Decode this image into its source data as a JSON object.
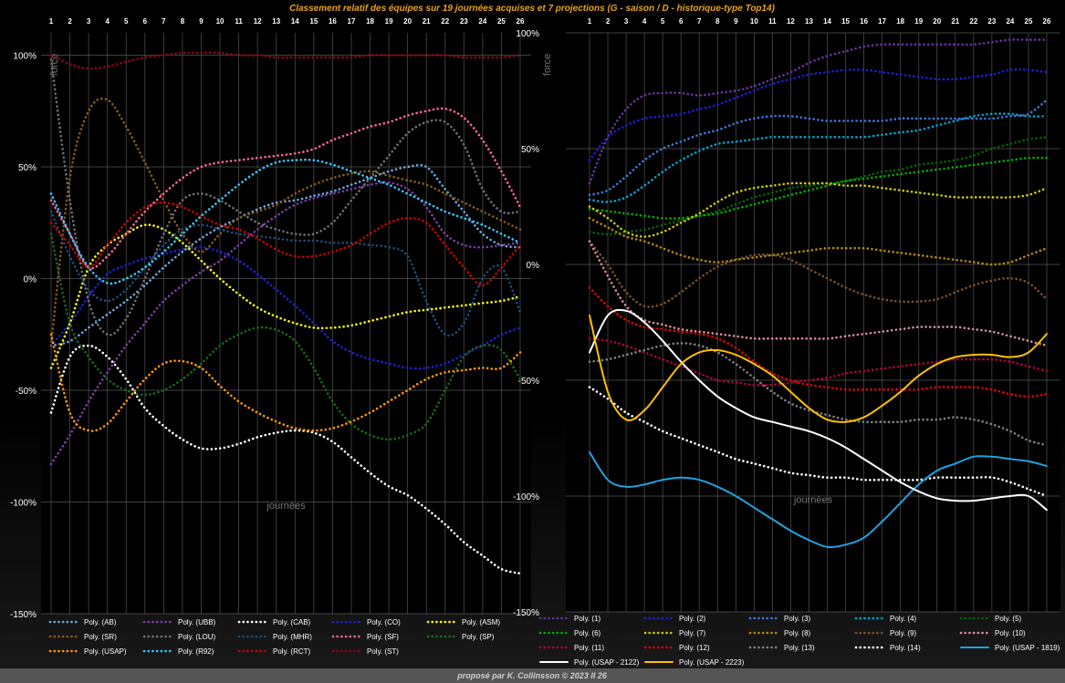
{
  "title": "Classement relatif des équipes sur 19 journées acquises et 7 projections  (G - saison   /   D - historique-type Top14)",
  "footer": "proposé par K. Collinsson  ©  2023 II 26",
  "colors": {
    "background": "#000000",
    "title": "#e8a317",
    "gridline": "#555555"
  },
  "chart_data": [
    {
      "type": "line",
      "panel": "left",
      "x": [
        1,
        2,
        3,
        4,
        5,
        6,
        7,
        8,
        9,
        10,
        11,
        12,
        13,
        14,
        15,
        16,
        17,
        18,
        19,
        20,
        21,
        22,
        23,
        24,
        25,
        26
      ],
      "xlabel": "journées",
      "ylabel": "force",
      "ylim": [
        -150,
        110
      ],
      "yticks": [
        100,
        50,
        0,
        -50,
        -100,
        -150
      ],
      "ytick_labels": [
        "100%",
        "50%",
        "0%",
        "-50%",
        "-100%",
        "-150%"
      ],
      "grid": true,
      "legend_position": "bottom",
      "series": [
        {
          "name": "Poly. (AB)",
          "color": "#6fa8dc",
          "style": "dotted",
          "values": [
            -30,
            -28,
            -22,
            -16,
            -10,
            -3,
            5,
            12,
            18,
            23,
            27,
            31,
            34,
            35,
            37,
            39,
            42,
            45,
            48,
            50,
            50,
            40,
            30,
            20,
            15,
            14
          ]
        },
        {
          "name": "Poly. (UBB)",
          "color": "#7e3fa6",
          "style": "dotted",
          "values": [
            -83,
            -70,
            -55,
            -42,
            -30,
            -20,
            -10,
            -3,
            3,
            8,
            15,
            22,
            28,
            33,
            36,
            38,
            40,
            42,
            43,
            40,
            32,
            20,
            15,
            14,
            15,
            16
          ]
        },
        {
          "name": "Poly. (CAB)",
          "color": "#ffffff",
          "style": "dotted",
          "values": [
            -60,
            -35,
            -30,
            -35,
            -45,
            -58,
            -66,
            -72,
            -76,
            -76,
            -74,
            -71,
            -69,
            -68,
            -69,
            -73,
            -80,
            -87,
            -93,
            -97,
            -103,
            -110,
            -118,
            -124,
            -130,
            -132
          ]
        },
        {
          "name": "Poly. (CO)",
          "color": "#1f1fd6",
          "style": "dotted",
          "values": [
            -30,
            -20,
            -8,
            2,
            6,
            9,
            11,
            13,
            14,
            12,
            8,
            2,
            -5,
            -12,
            -20,
            -28,
            -33,
            -36,
            -38,
            -40,
            -40,
            -38,
            -34,
            -30,
            -25,
            -22
          ]
        },
        {
          "name": "Poly. (ASM)",
          "color": "#ffff00",
          "style": "dotted",
          "values": [
            -40,
            -20,
            5,
            15,
            20,
            24,
            22,
            16,
            8,
            0,
            -7,
            -13,
            -17,
            -20,
            -22,
            -22,
            -21,
            -19,
            -17,
            -15,
            -14,
            -13,
            -12,
            -11,
            -10,
            -8
          ]
        },
        {
          "name": "Poly. (SR)",
          "color": "#8b5a1a",
          "style": "dotted",
          "values": [
            -30,
            45,
            75,
            80,
            68,
            52,
            35,
            20,
            12,
            20,
            27,
            30,
            33,
            38,
            42,
            45,
            47,
            48,
            46,
            44,
            42,
            38,
            34,
            30,
            26,
            22
          ]
        },
        {
          "name": "Poly. (LOU)",
          "color": "#707070",
          "style": "dotted",
          "values": [
            98,
            35,
            -10,
            -25,
            -18,
            0,
            20,
            35,
            38,
            35,
            30,
            25,
            22,
            20,
            20,
            25,
            35,
            45,
            55,
            65,
            70,
            70,
            60,
            40,
            30,
            30
          ]
        },
        {
          "name": "Poly. (MHR)",
          "color": "#1f4e79",
          "style": "dotted",
          "values": [
            30,
            10,
            -5,
            -10,
            -5,
            5,
            15,
            22,
            24,
            22,
            20,
            19,
            18,
            17,
            17,
            16,
            16,
            15,
            14,
            10,
            -10,
            -25,
            -20,
            0,
            5,
            -15
          ]
        },
        {
          "name": "Poly. (SF)",
          "color": "#ff6699",
          "style": "dotted",
          "values": [
            35,
            20,
            5,
            10,
            20,
            30,
            38,
            45,
            50,
            52,
            53,
            54,
            55,
            56,
            58,
            62,
            65,
            68,
            70,
            73,
            75,
            76,
            72,
            62,
            48,
            32
          ]
        },
        {
          "name": "Poly. (SP)",
          "color": "#1a6b1a",
          "style": "dotted",
          "values": [
            20,
            -20,
            -35,
            -45,
            -50,
            -52,
            -50,
            -45,
            -38,
            -30,
            -25,
            -22,
            -23,
            -28,
            -40,
            -55,
            -65,
            -70,
            -72,
            -70,
            -65,
            -50,
            -35,
            -30,
            -32,
            -45
          ]
        },
        {
          "name": "Poly. (USAP)",
          "color": "#ff9900",
          "style": "dotted",
          "values": [
            -25,
            -60,
            -68,
            -65,
            -55,
            -45,
            -38,
            -37,
            -40,
            -48,
            -55,
            -60,
            -64,
            -67,
            -68,
            -67,
            -64,
            -60,
            -55,
            -50,
            -45,
            -42,
            -41,
            -40,
            -40,
            -33
          ]
        },
        {
          "name": "Poly. (R92)",
          "color": "#33ccff",
          "style": "dotted",
          "values": [
            38,
            20,
            5,
            -2,
            0,
            5,
            12,
            20,
            28,
            35,
            42,
            48,
            52,
            53,
            53,
            51,
            48,
            45,
            42,
            38,
            34,
            30,
            27,
            24,
            20,
            16
          ]
        },
        {
          "name": "Poly. (RCT)",
          "color": "#cc0000",
          "style": "dotted",
          "values": [
            25,
            15,
            5,
            15,
            25,
            32,
            34,
            32,
            28,
            24,
            22,
            18,
            13,
            10,
            10,
            12,
            15,
            20,
            25,
            27,
            25,
            15,
            5,
            -3,
            5,
            15
          ]
        },
        {
          "name": "Poly. (ST)",
          "color": "#99001a",
          "style": "dotted",
          "values": [
            100,
            96,
            94,
            95,
            97,
            99,
            100,
            101,
            101,
            101,
            100,
            100,
            99,
            99,
            99,
            99,
            99,
            100,
            100,
            100,
            100,
            100,
            99,
            99,
            99,
            100
          ]
        }
      ]
    },
    {
      "type": "line",
      "panel": "right",
      "x": [
        1,
        2,
        3,
        4,
        5,
        6,
        7,
        8,
        9,
        10,
        11,
        12,
        13,
        14,
        15,
        16,
        17,
        18,
        19,
        20,
        21,
        22,
        23,
        24,
        25,
        26
      ],
      "xlabel": "journées",
      "ylabel": "force",
      "ylim": [
        -150,
        100
      ],
      "yticks": [
        100,
        50,
        0,
        -50,
        -100,
        -150
      ],
      "ytick_labels": [
        "100%",
        "50%",
        "0%",
        "-50%",
        "-100%",
        "-150%"
      ],
      "grid": true,
      "legend_position": "bottom",
      "series": [
        {
          "name": "Poly. (1)",
          "color": "#6a329f",
          "style": "dotted",
          "values": [
            35,
            55,
            67,
            73,
            74,
            74,
            73,
            74,
            75,
            77,
            80,
            83,
            87,
            90,
            92,
            94,
            95,
            95,
            95,
            95,
            95,
            95,
            96,
            97,
            97,
            97
          ]
        },
        {
          "name": "Poly. (2)",
          "color": "#1f1fd6",
          "style": "dotted",
          "values": [
            45,
            55,
            60,
            63,
            64,
            65,
            67,
            69,
            72,
            75,
            78,
            80,
            82,
            83,
            84,
            84,
            83,
            82,
            81,
            80,
            80,
            81,
            82,
            84,
            84,
            83
          ]
        },
        {
          "name": "Poly. (3)",
          "color": "#3c78d8",
          "style": "dotted",
          "values": [
            30,
            32,
            38,
            45,
            50,
            53,
            56,
            58,
            61,
            63,
            64,
            64,
            63,
            62,
            62,
            62,
            62,
            63,
            63,
            63,
            63,
            63,
            63,
            64,
            65,
            71
          ]
        },
        {
          "name": "Poly. (4)",
          "color": "#00a3cc",
          "style": "dotted",
          "values": [
            28,
            27,
            29,
            34,
            40,
            45,
            49,
            52,
            53,
            54,
            55,
            55,
            55,
            55,
            55,
            55,
            56,
            57,
            58,
            60,
            62,
            64,
            65,
            65,
            64,
            64
          ]
        },
        {
          "name": "Poly. (5)",
          "color": "#006400",
          "style": "dotted",
          "values": [
            14,
            13,
            14,
            15,
            17,
            19,
            21,
            23,
            26,
            29,
            31,
            33,
            34,
            35,
            36,
            38,
            40,
            41,
            43,
            44,
            45,
            47,
            50,
            52,
            54,
            55
          ]
        },
        {
          "name": "Poly. (6)",
          "color": "#00aa00",
          "style": "dotted",
          "values": [
            24,
            23,
            22,
            21,
            20,
            20,
            21,
            22,
            24,
            26,
            28,
            30,
            32,
            34,
            36,
            37,
            38,
            39,
            40,
            41,
            42,
            43,
            44,
            45,
            46,
            46
          ]
        },
        {
          "name": "Poly. (7)",
          "color": "#cccc00",
          "style": "dotted",
          "values": [
            25,
            20,
            14,
            12,
            14,
            18,
            22,
            27,
            31,
            33,
            34,
            35,
            35,
            35,
            34,
            34,
            33,
            32,
            31,
            30,
            29,
            29,
            29,
            29,
            30,
            33
          ]
        },
        {
          "name": "Poly. (8)",
          "color": "#b8860b",
          "style": "dotted",
          "values": [
            20,
            16,
            12,
            10,
            7,
            4,
            2,
            1,
            2,
            3,
            4,
            5,
            6,
            7,
            7,
            7,
            6,
            5,
            4,
            3,
            2,
            1,
            0,
            1,
            4,
            7
          ]
        },
        {
          "name": "Poly. (9)",
          "color": "#7a5230",
          "style": "dotted",
          "values": [
            10,
            0,
            -12,
            -18,
            -17,
            -12,
            -6,
            -1,
            2,
            4,
            4,
            2,
            -2,
            -6,
            -10,
            -13,
            -15,
            -16,
            -16,
            -15,
            -12,
            -9,
            -7,
            -6,
            -8,
            -15
          ]
        },
        {
          "name": "Poly. (10)",
          "color": "#d98c9a",
          "style": "dotted",
          "values": [
            10,
            -5,
            -18,
            -24,
            -26,
            -28,
            -29,
            -30,
            -31,
            -32,
            -32,
            -32,
            -32,
            -32,
            -31,
            -30,
            -29,
            -28,
            -27,
            -27,
            -27,
            -28,
            -29,
            -31,
            -33,
            -35
          ]
        },
        {
          "name": "Poly. (11)",
          "color": "#b3003b",
          "style": "dotted",
          "values": [
            -32,
            -33,
            -35,
            -38,
            -41,
            -44,
            -47,
            -50,
            -51,
            -52,
            -52,
            -51,
            -50,
            -49,
            -47,
            -46,
            -45,
            -44,
            -43,
            -42,
            -41,
            -41,
            -41,
            -42,
            -44,
            -46
          ]
        },
        {
          "name": "Poly. (12)",
          "color": "#e60000",
          "style": "dotted",
          "values": [
            -10,
            -18,
            -24,
            -27,
            -28,
            -29,
            -30,
            -32,
            -36,
            -42,
            -47,
            -50,
            -52,
            -53,
            -54,
            -54,
            -54,
            -54,
            -54,
            -53,
            -53,
            -53,
            -54,
            -56,
            -57,
            -56
          ]
        },
        {
          "name": "Poly. (13)",
          "color": "#808080",
          "style": "dotted",
          "values": [
            -42,
            -41,
            -39,
            -37,
            -35,
            -34,
            -35,
            -38,
            -43,
            -49,
            -55,
            -60,
            -63,
            -65,
            -67,
            -68,
            -68,
            -68,
            -67,
            -67,
            -66,
            -67,
            -69,
            -72,
            -76,
            -78
          ]
        },
        {
          "name": "Poly. (14)",
          "color": "#ffffff",
          "style": "dotted",
          "values": [
            -53,
            -58,
            -64,
            -68,
            -72,
            -75,
            -78,
            -81,
            -84,
            -86,
            -88,
            -90,
            -91,
            -92,
            -92,
            -93,
            -93,
            -93,
            -93,
            -92,
            -92,
            -92,
            -92,
            -94,
            -97,
            -100
          ]
        },
        {
          "name": "Poly. (USAP - 1819)",
          "color": "#1fa3e0",
          "style": "solid",
          "values": [
            -81,
            -93,
            -96,
            -95,
            -93,
            -92,
            -93,
            -96,
            -100,
            -105,
            -110,
            -115,
            -119,
            -122,
            -121,
            -118,
            -111,
            -103,
            -95,
            -89,
            -86,
            -83,
            -83,
            -84,
            -85,
            -87
          ]
        },
        {
          "name": "Poly. (USAP - 2122)",
          "color": "#ffffff",
          "style": "solid",
          "values": [
            -38,
            -22,
            -20,
            -25,
            -33,
            -42,
            -50,
            -57,
            -62,
            -66,
            -68,
            -70,
            -72,
            -75,
            -79,
            -84,
            -89,
            -94,
            -98,
            -101,
            -102,
            -102,
            -101,
            -100,
            -100,
            -106
          ]
        },
        {
          "name": "Poly. (USAP - 2223)",
          "color": "#ffc000",
          "style": "solid",
          "values": [
            -22,
            -55,
            -67,
            -63,
            -53,
            -43,
            -38,
            -37,
            -39,
            -43,
            -48,
            -55,
            -62,
            -67,
            -68,
            -66,
            -61,
            -55,
            -48,
            -43,
            -40,
            -39,
            -39,
            -40,
            -38,
            -30
          ]
        }
      ]
    }
  ]
}
